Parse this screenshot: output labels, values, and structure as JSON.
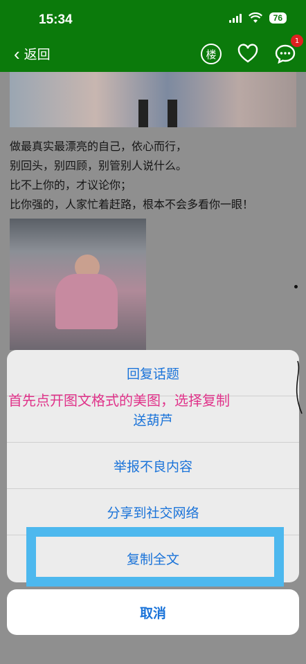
{
  "status": {
    "time": "15:34",
    "battery": "76"
  },
  "nav": {
    "back_label": "返回",
    "floor_icon_label": "楼",
    "chat_badge": "1"
  },
  "post": {
    "lines": [
      "做最真实最漂亮的自己，依心而行，",
      "别回头，别四顾，别管别人说什么。",
      "比不上你的，才议论你；",
      "比你强的，人家忙着赶路，根本不会多看你一眼！"
    ]
  },
  "sheet": {
    "items": [
      "回复话题",
      "送葫芦",
      "举报不良内容",
      "分享到社交网络",
      "复制全文"
    ],
    "cancel": "取消"
  },
  "annotation": {
    "text": "首先点开图文格式的美图，选择复制"
  },
  "colors": {
    "nav_green": "#0b7a0b",
    "sheet_blue_text": "#1a73d9",
    "highlight_border": "#4db8ee",
    "annotation_pink": "#e0338a"
  }
}
